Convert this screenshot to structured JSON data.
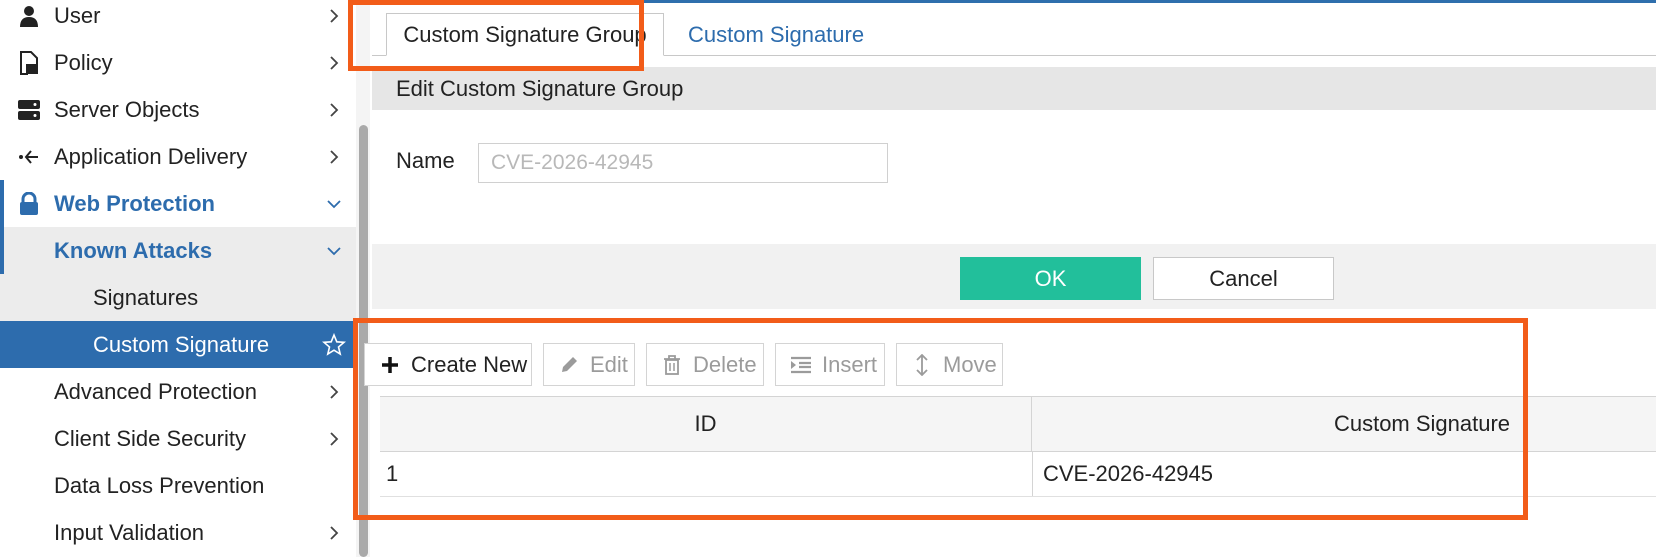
{
  "sidebar": {
    "items": [
      {
        "label": "User",
        "icon": "user-icon"
      },
      {
        "label": "Policy",
        "icon": "policy-icon"
      },
      {
        "label": "Server Objects",
        "icon": "server-icon"
      },
      {
        "label": "Application Delivery",
        "icon": "app-delivery-icon"
      },
      {
        "label": "Web Protection",
        "icon": "lock-icon"
      },
      {
        "label": "Known Attacks"
      },
      {
        "label": "Signatures"
      },
      {
        "label": "Custom Signature"
      },
      {
        "label": "Advanced Protection"
      },
      {
        "label": "Client Side Security"
      },
      {
        "label": "Data Loss Prevention"
      },
      {
        "label": "Input Validation"
      }
    ]
  },
  "tabs": [
    {
      "label": "Custom Signature Group",
      "active": true
    },
    {
      "label": "Custom Signature",
      "active": false
    }
  ],
  "form": {
    "header": "Edit Custom Signature Group",
    "name_label": "Name",
    "name_placeholder": "CVE-2026-42945"
  },
  "buttons": {
    "ok": "OK",
    "cancel": "Cancel"
  },
  "toolbar": {
    "create_new": "Create New",
    "edit": "Edit",
    "delete": "Delete",
    "insert": "Insert",
    "move": "Move"
  },
  "table": {
    "columns": [
      "ID",
      "Custom Signature"
    ],
    "rows": [
      {
        "id": "1",
        "signature": "CVE-2026-42945"
      }
    ]
  },
  "colors": {
    "accent": "#2d6cad",
    "ok_button": "#22bf9b",
    "highlight": "#f25c19"
  }
}
